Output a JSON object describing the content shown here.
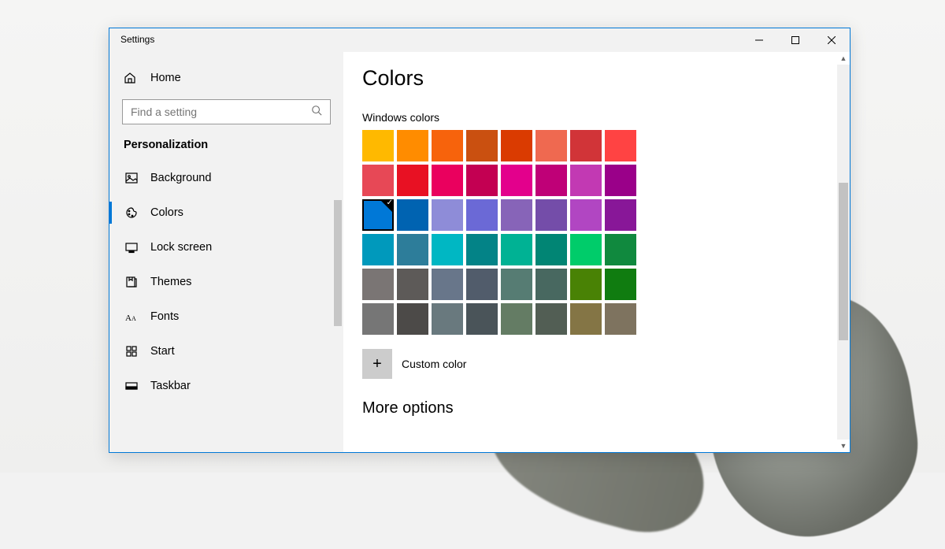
{
  "window": {
    "title": "Settings"
  },
  "sidebar": {
    "home": "Home",
    "search_placeholder": "Find a setting",
    "category": "Personalization",
    "items": [
      {
        "label": "Background",
        "icon": "picture-icon",
        "active": false
      },
      {
        "label": "Colors",
        "icon": "palette-icon",
        "active": true
      },
      {
        "label": "Lock screen",
        "icon": "lock-screen-icon",
        "active": false
      },
      {
        "label": "Themes",
        "icon": "themes-icon",
        "active": false
      },
      {
        "label": "Fonts",
        "icon": "fonts-icon",
        "active": false
      },
      {
        "label": "Start",
        "icon": "start-icon",
        "active": false
      },
      {
        "label": "Taskbar",
        "icon": "taskbar-icon",
        "active": false
      }
    ]
  },
  "content": {
    "title": "Colors",
    "section_label": "Windows colors",
    "custom_color_label": "Custom color",
    "more_options_label": "More options",
    "selected_index": 16,
    "swatches": [
      "#FFB900",
      "#FF8C00",
      "#F7630C",
      "#CA5010",
      "#DA3B01",
      "#EF6950",
      "#D13438",
      "#FF4343",
      "#E74856",
      "#E81123",
      "#EA005E",
      "#C30052",
      "#E3008C",
      "#BF0077",
      "#C239B3",
      "#9A0089",
      "#0078D7",
      "#0063B1",
      "#8E8CD8",
      "#6B69D6",
      "#8764B8",
      "#744DA9",
      "#B146C2",
      "#881798",
      "#0099BC",
      "#2D7D9A",
      "#00B7C3",
      "#038387",
      "#00B294",
      "#018574",
      "#00CC6A",
      "#10893E",
      "#7A7574",
      "#5D5A58",
      "#68768A",
      "#515C6B",
      "#567C73",
      "#486860",
      "#498205",
      "#107C10",
      "#767676",
      "#4C4A48",
      "#69797E",
      "#4A5459",
      "#647C64",
      "#525E54",
      "#847545",
      "#7E735F"
    ]
  }
}
